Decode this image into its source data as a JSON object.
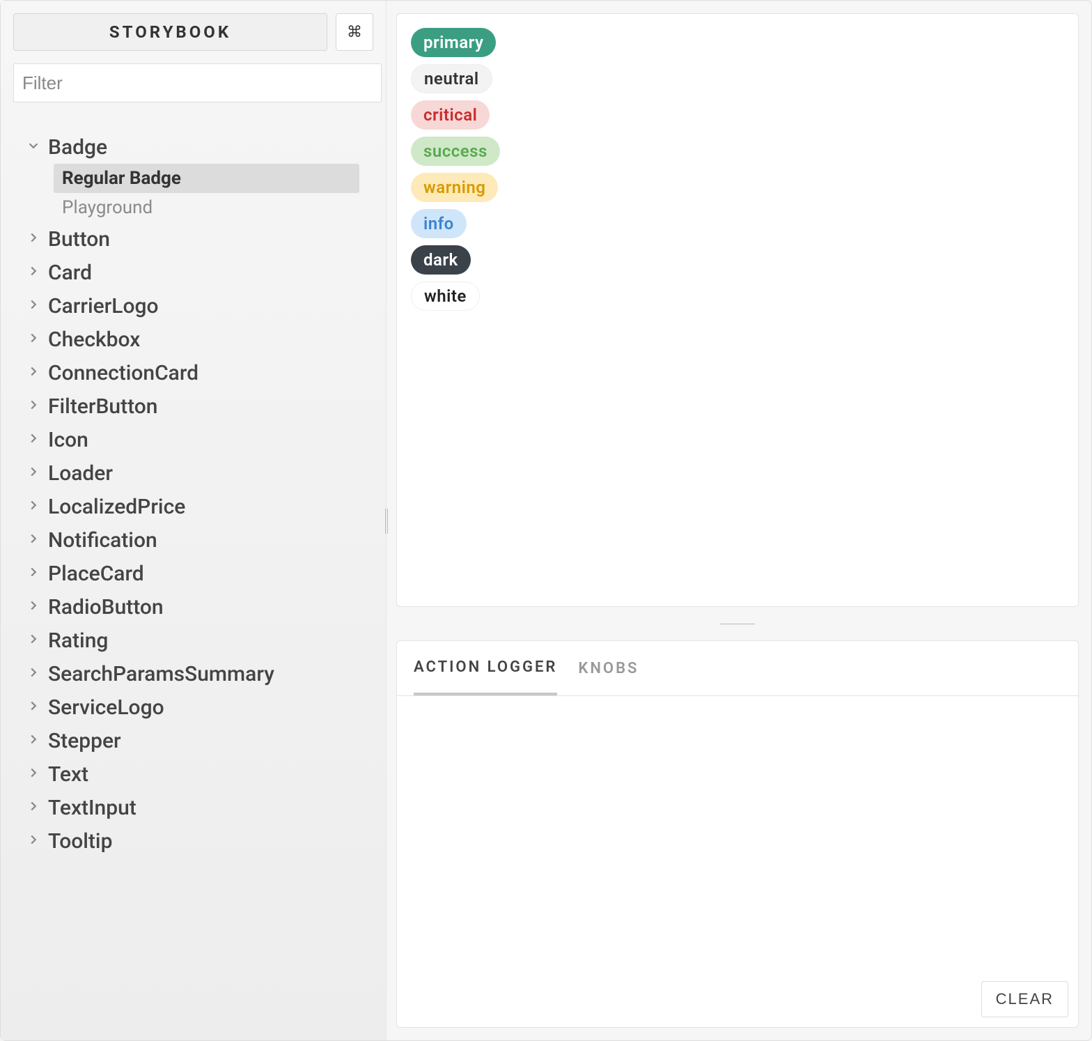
{
  "sidebar": {
    "brand": "STORYBOOK",
    "cmd_icon_name": "command-icon",
    "filter_placeholder": "Filter",
    "expanded": {
      "label": "Badge",
      "children": [
        {
          "label": "Regular Badge",
          "active": true
        },
        {
          "label": "Playground",
          "active": false
        }
      ]
    },
    "items": [
      {
        "label": "Button"
      },
      {
        "label": "Card"
      },
      {
        "label": "CarrierLogo"
      },
      {
        "label": "Checkbox"
      },
      {
        "label": "ConnectionCard"
      },
      {
        "label": "FilterButton"
      },
      {
        "label": "Icon"
      },
      {
        "label": "Loader"
      },
      {
        "label": "LocalizedPrice"
      },
      {
        "label": "Notification"
      },
      {
        "label": "PlaceCard"
      },
      {
        "label": "RadioButton"
      },
      {
        "label": "Rating"
      },
      {
        "label": "SearchParamsSummary"
      },
      {
        "label": "ServiceLogo"
      },
      {
        "label": "Stepper"
      },
      {
        "label": "Text"
      },
      {
        "label": "TextInput"
      },
      {
        "label": "Tooltip"
      }
    ]
  },
  "preview": {
    "badges": [
      {
        "label": "primary",
        "variant": "primary"
      },
      {
        "label": "neutral",
        "variant": "neutral"
      },
      {
        "label": "critical",
        "variant": "critical"
      },
      {
        "label": "success",
        "variant": "success"
      },
      {
        "label": "warning",
        "variant": "warning"
      },
      {
        "label": "info",
        "variant": "info"
      },
      {
        "label": "dark",
        "variant": "dark"
      },
      {
        "label": "white",
        "variant": "white"
      }
    ]
  },
  "panel": {
    "tabs": [
      {
        "label": "ACTION LOGGER",
        "active": true
      },
      {
        "label": "KNOBS",
        "active": false
      }
    ],
    "clear_label": "CLEAR"
  }
}
